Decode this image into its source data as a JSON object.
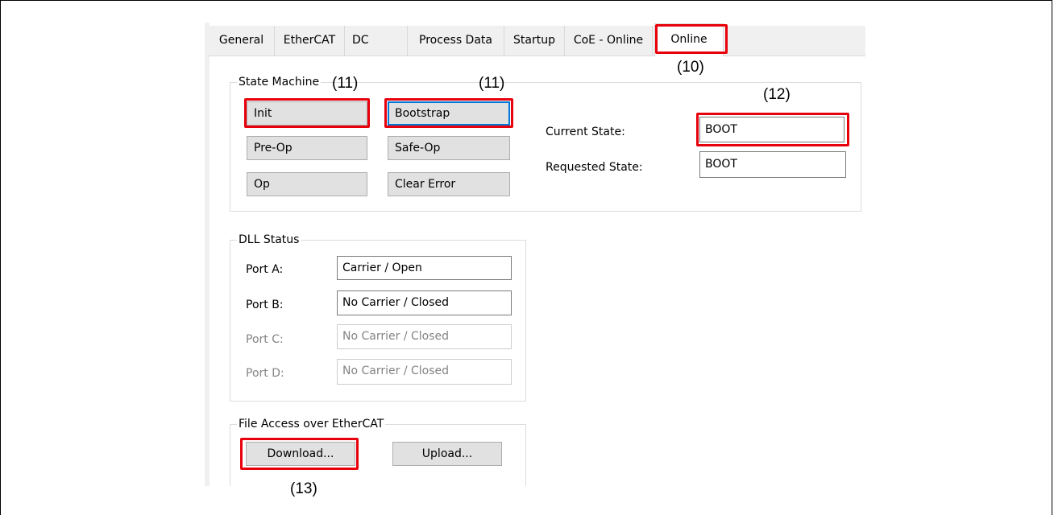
{
  "tabs": [
    "General",
    "EtherCAT",
    "DC",
    "Process Data",
    "Startup",
    "CoE - Online",
    "Online"
  ],
  "active_tab": "Online",
  "state_machine": {
    "title": "State Machine",
    "buttons": {
      "init": "Init",
      "bootstrap": "Bootstrap",
      "preop": "Pre-Op",
      "safeop": "Safe-Op",
      "op": "Op",
      "clear_error": "Clear Error"
    },
    "current_state_label": "Current State:",
    "current_state_value": "BOOT",
    "requested_state_label": "Requested State:",
    "requested_state_value": "BOOT"
  },
  "dll_status": {
    "title": "DLL Status",
    "ports": [
      {
        "label": "Port A:",
        "value": "Carrier / Open",
        "enabled": true
      },
      {
        "label": "Port B:",
        "value": "No Carrier / Closed",
        "enabled": true
      },
      {
        "label": "Port C:",
        "value": "No Carrier / Closed",
        "enabled": false
      },
      {
        "label": "Port D:",
        "value": "No Carrier / Closed",
        "enabled": false
      }
    ]
  },
  "file_access": {
    "title": "File Access over EtherCAT",
    "download": "Download...",
    "upload": "Upload..."
  },
  "callouts": {
    "c10": "(10)",
    "c11a": "(11)",
    "c11b": "(11)",
    "c12": "(12)",
    "c13": "(13)"
  },
  "colors": {
    "highlight": "#e8000b",
    "focus": "#0078d7"
  }
}
